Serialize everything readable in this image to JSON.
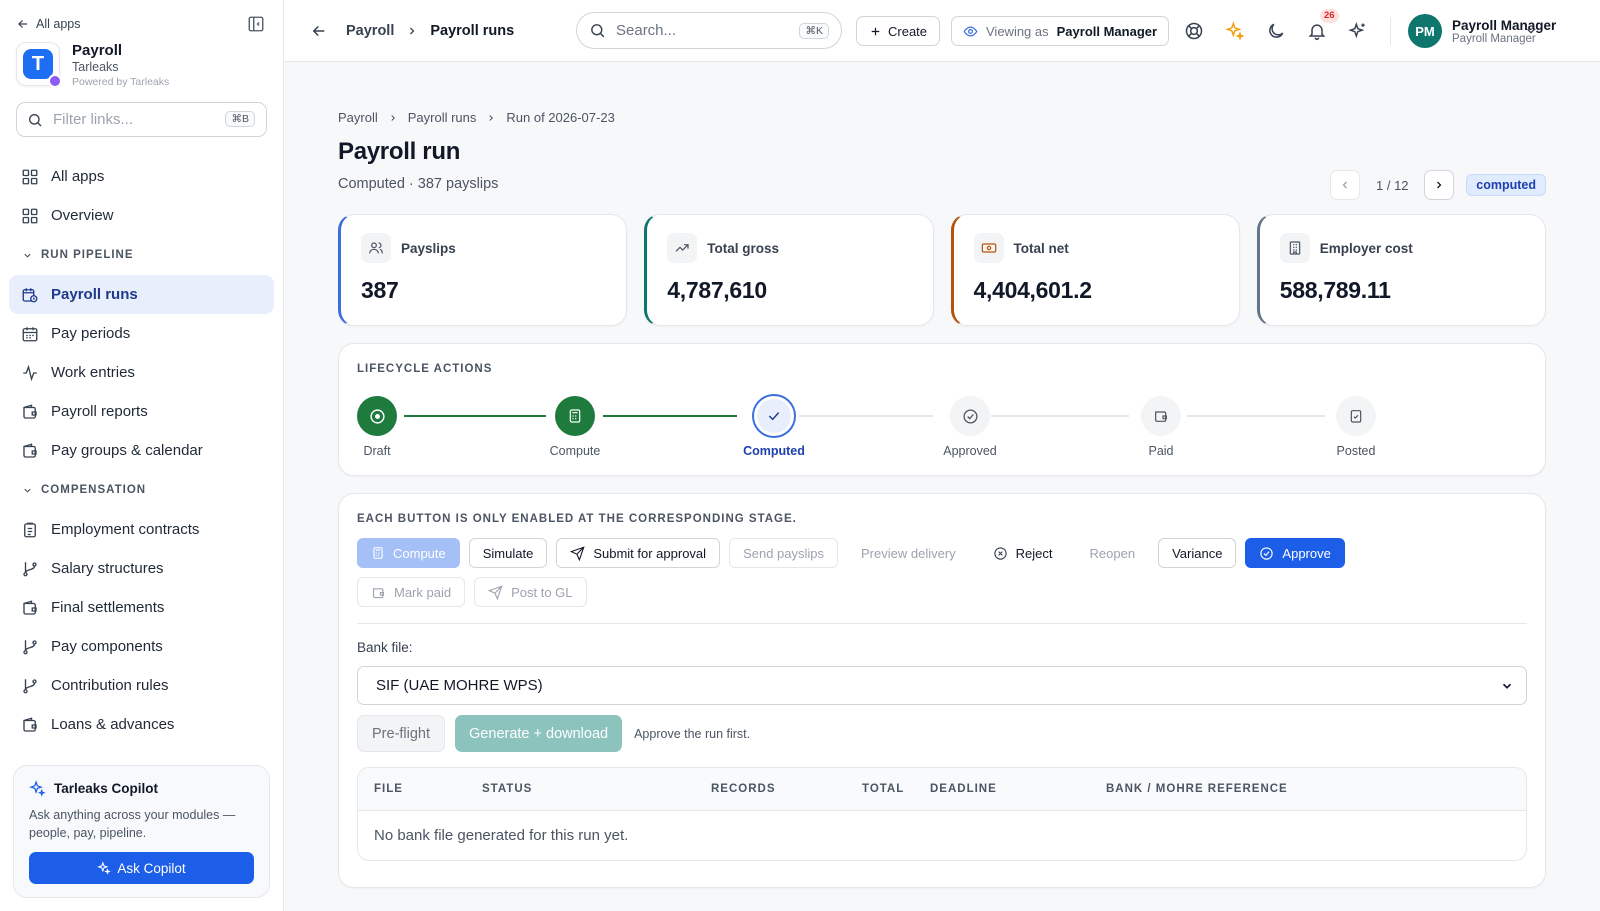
{
  "sidebar": {
    "back_label": "All apps",
    "app_title": "Payroll",
    "org": "Tarleaks",
    "powered": "Powered by Tarleaks",
    "filter_placeholder": "Filter links...",
    "filter_kbd": "⌘B",
    "top_items": [
      {
        "label": "All apps"
      },
      {
        "label": "Overview"
      }
    ],
    "sections": [
      {
        "title": "RUN PIPELINE",
        "items": [
          {
            "label": "Payroll runs"
          },
          {
            "label": "Pay periods"
          },
          {
            "label": "Work entries"
          },
          {
            "label": "Payroll reports"
          },
          {
            "label": "Pay groups & calendar"
          }
        ]
      },
      {
        "title": "COMPENSATION",
        "items": [
          {
            "label": "Employment contracts"
          },
          {
            "label": "Salary structures"
          },
          {
            "label": "Final settlements"
          },
          {
            "label": "Pay components"
          },
          {
            "label": "Contribution rules"
          },
          {
            "label": "Loans & advances"
          }
        ]
      }
    ],
    "copilot": {
      "title": "Tarleaks Copilot",
      "desc": "Ask anything across your modules — people, pay, pipeline.",
      "button": "Ask Copilot"
    }
  },
  "topbar": {
    "crumb1": "Payroll",
    "crumb2": "Payroll runs",
    "search_placeholder": "Search...",
    "search_kbd": "⌘K",
    "create": "Create",
    "viewing_prefix": "Viewing as",
    "viewing_role": "Payroll Manager",
    "notifications": "26",
    "user": {
      "initials": "PM",
      "name": "Payroll Manager",
      "role": "Payroll Manager"
    }
  },
  "page": {
    "breadcrumb": [
      "Payroll",
      "Payroll runs",
      "Run of 2026-07-23"
    ],
    "title": "Payroll run",
    "subtitle": "Computed · 387 payslips",
    "pager": "1 / 12",
    "status": "computed"
  },
  "kpis": [
    {
      "label": "Payslips",
      "value": "387",
      "color": "#3b6fe0"
    },
    {
      "label": "Total gross",
      "value": "4,787,610",
      "color": "#0f766e"
    },
    {
      "label": "Total net",
      "value": "4,404,601.2",
      "color": "#b45309"
    },
    {
      "label": "Employer cost",
      "value": "588,789.11",
      "color": "#64748b"
    }
  ],
  "lifecycle": {
    "title": "LIFECYCLE ACTIONS",
    "steps": [
      {
        "label": "Draft",
        "state": "done"
      },
      {
        "label": "Compute",
        "state": "done"
      },
      {
        "label": "Computed",
        "state": "current"
      },
      {
        "label": "Approved",
        "state": "todo"
      },
      {
        "label": "Paid",
        "state": "todo"
      },
      {
        "label": "Posted",
        "state": "todo"
      }
    ]
  },
  "actions": {
    "title": "EACH BUTTON IS ONLY ENABLED AT THE CORRESPONDING STAGE.",
    "buttons": {
      "compute": "Compute",
      "simulate": "Simulate",
      "submit": "Submit for approval",
      "send": "Send payslips",
      "preview": "Preview delivery",
      "reject": "Reject",
      "reopen": "Reopen",
      "variance": "Variance",
      "approve": "Approve",
      "mark_paid": "Mark paid",
      "post_gl": "Post to GL"
    },
    "bank_label": "Bank file:",
    "bank_selected": "SIF (UAE MOHRE WPS)",
    "preflight": "Pre-flight",
    "generate": "Generate + download",
    "hint": "Approve the run first.",
    "table": {
      "columns": [
        "FILE",
        "STATUS",
        "RECORDS",
        "TOTAL",
        "DEADLINE",
        "BANK / MOHRE REFERENCE"
      ],
      "empty": "No bank file generated for this run yet."
    }
  }
}
